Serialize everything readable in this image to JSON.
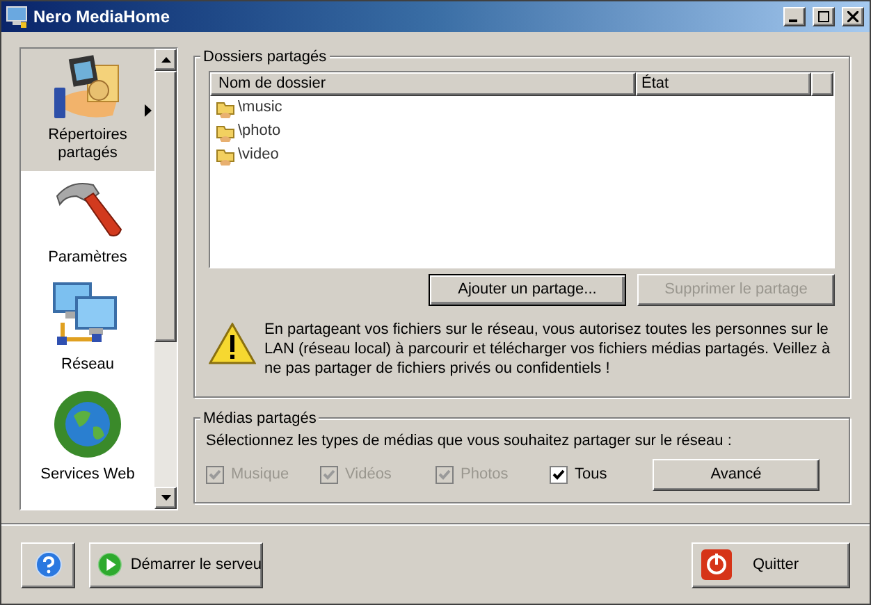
{
  "window": {
    "title": "Nero MediaHome"
  },
  "sidebar": {
    "items": [
      {
        "label": "Répertoires partagés",
        "kind": "folders",
        "selected": true
      },
      {
        "label": "Paramètres",
        "kind": "hammer",
        "selected": false
      },
      {
        "label": "Réseau",
        "kind": "network",
        "selected": false
      },
      {
        "label": "Services Web",
        "kind": "globe",
        "selected": false
      }
    ]
  },
  "shared_folders": {
    "title": "Dossiers partagés",
    "columns": [
      "Nom de dossier",
      "État"
    ],
    "rows": [
      {
        "name": "\\music"
      },
      {
        "name": "\\photo"
      },
      {
        "name": "\\video"
      }
    ],
    "buttons": [
      {
        "label": "Ajouter un partage...",
        "disabled": false
      },
      {
        "label": "Supprimer le partage",
        "disabled": true
      }
    ],
    "warning": "En partageant vos fichiers sur le réseau, vous autorisez toutes les personnes sur le LAN (réseau local) à parcourir et télécharger vos fichiers médias partagés. Veillez à ne pas partager de fichiers privés ou confidentiels !"
  },
  "shared_media": {
    "title": "Médias partagés",
    "prompt": "Sélectionnez les types de médias que vous souhaitez partager sur le réseau :",
    "options": [
      {
        "label": "Musique",
        "checked": true,
        "disabled": true
      },
      {
        "label": "Vidéos",
        "checked": true,
        "disabled": true
      },
      {
        "label": "Photos",
        "checked": true,
        "disabled": true
      },
      {
        "label": "Tous",
        "checked": true,
        "disabled": false
      }
    ],
    "advanced_button": "Avancé"
  },
  "footer": {
    "start_button": "Démarrer le serveu",
    "quit_button": "Quitter"
  }
}
